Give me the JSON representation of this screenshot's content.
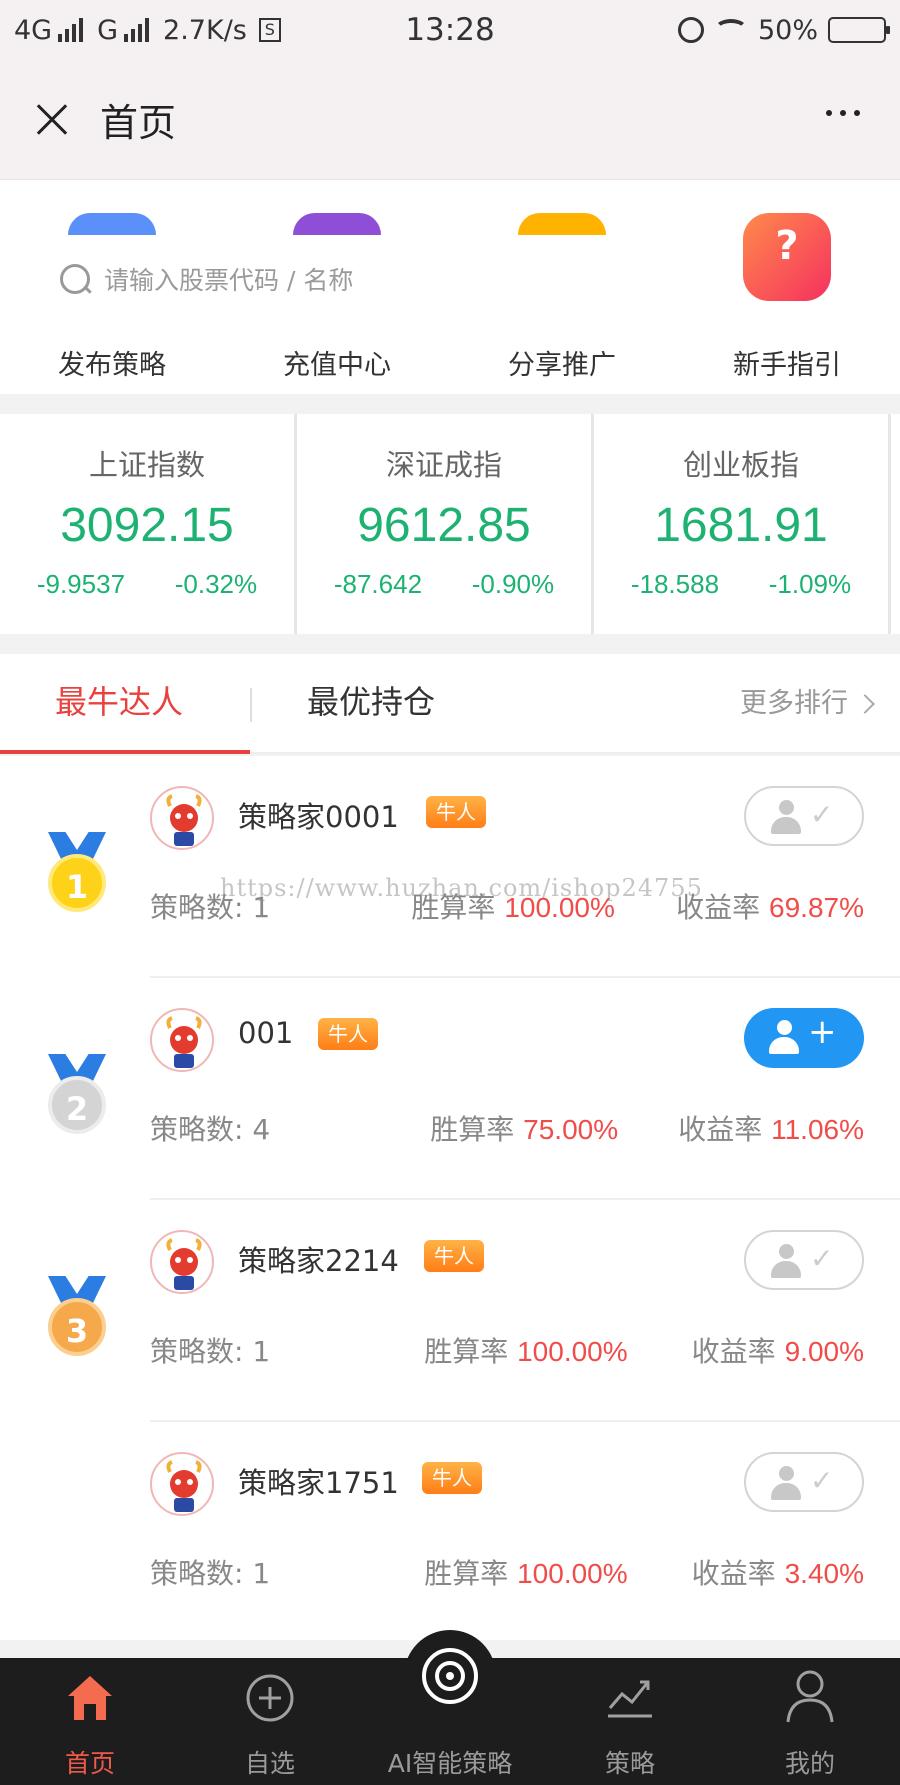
{
  "status_bar": {
    "network1": "4G",
    "network2": "G",
    "speed": "2.7K/s",
    "time": "13:28",
    "battery": "50%",
    "battery_level": 0.5
  },
  "nav": {
    "title": "首页"
  },
  "search": {
    "placeholder": "请输入股票代码 / 名称"
  },
  "quick_menu": [
    {
      "label": "发布策略",
      "icon": "publish-icon",
      "color": "#5b8ff9"
    },
    {
      "label": "充值中心",
      "icon": "recharge-icon",
      "color": "#8e4fd6"
    },
    {
      "label": "分享推广",
      "icon": "share-icon",
      "color": "#ffb300"
    },
    {
      "label": "新手指引",
      "icon": "guide-icon",
      "color": "#ff6a5c"
    }
  ],
  "indices": [
    {
      "name": "上证指数",
      "value": "3092.15",
      "change": "-9.9537",
      "pct": "-0.32%"
    },
    {
      "name": "深证成指",
      "value": "9612.85",
      "change": "-87.642",
      "pct": "-0.90%"
    },
    {
      "name": "创业板指",
      "value": "1681.91",
      "change": "-18.588",
      "pct": "-1.09%"
    }
  ],
  "tabs": {
    "items": [
      "最牛达人",
      "最优持仓"
    ],
    "active": 0,
    "more": "更多排行"
  },
  "watermark": "https://www.huzhan.com/ishop24755",
  "ranking": [
    {
      "rank": "1",
      "name": "策略家0001",
      "badge": "牛人",
      "followed": false,
      "strategies_label": "策略数:",
      "strategies": "1",
      "win_label": "胜算率",
      "win": "100.00%",
      "yield_label": "收益率",
      "yield": "69.87%"
    },
    {
      "rank": "2",
      "name": "001",
      "badge": "牛人",
      "followed": true,
      "strategies_label": "策略数:",
      "strategies": "4",
      "win_label": "胜算率",
      "win": "75.00%",
      "yield_label": "收益率",
      "yield": "11.06%"
    },
    {
      "rank": "3",
      "name": "策略家2214",
      "badge": "牛人",
      "followed": false,
      "strategies_label": "策略数:",
      "strategies": "1",
      "win_label": "胜算率",
      "win": "100.00%",
      "yield_label": "收益率",
      "yield": "9.00%"
    },
    {
      "rank": "",
      "name": "策略家1751",
      "badge": "牛人",
      "followed": false,
      "strategies_label": "策略数:",
      "strategies": "1",
      "win_label": "胜算率",
      "win": "100.00%",
      "yield_label": "收益率",
      "yield": "3.40%"
    }
  ],
  "bottom_nav": [
    {
      "label": "首页",
      "icon": "home-icon",
      "active": true
    },
    {
      "label": "自选",
      "icon": "plus-circle-icon",
      "active": false
    },
    {
      "label": "AI智能策略",
      "icon": "target-icon",
      "active": false
    },
    {
      "label": "策略",
      "icon": "chart-icon",
      "active": false
    },
    {
      "label": "我的",
      "icon": "user-icon",
      "active": false
    }
  ],
  "colors": {
    "accent": "#e8413e",
    "up_green": "#1db272",
    "follow_blue": "#2196f3",
    "gold": "#ffd21a",
    "silver": "#d9d9d9",
    "bronze": "#f5a94a"
  }
}
